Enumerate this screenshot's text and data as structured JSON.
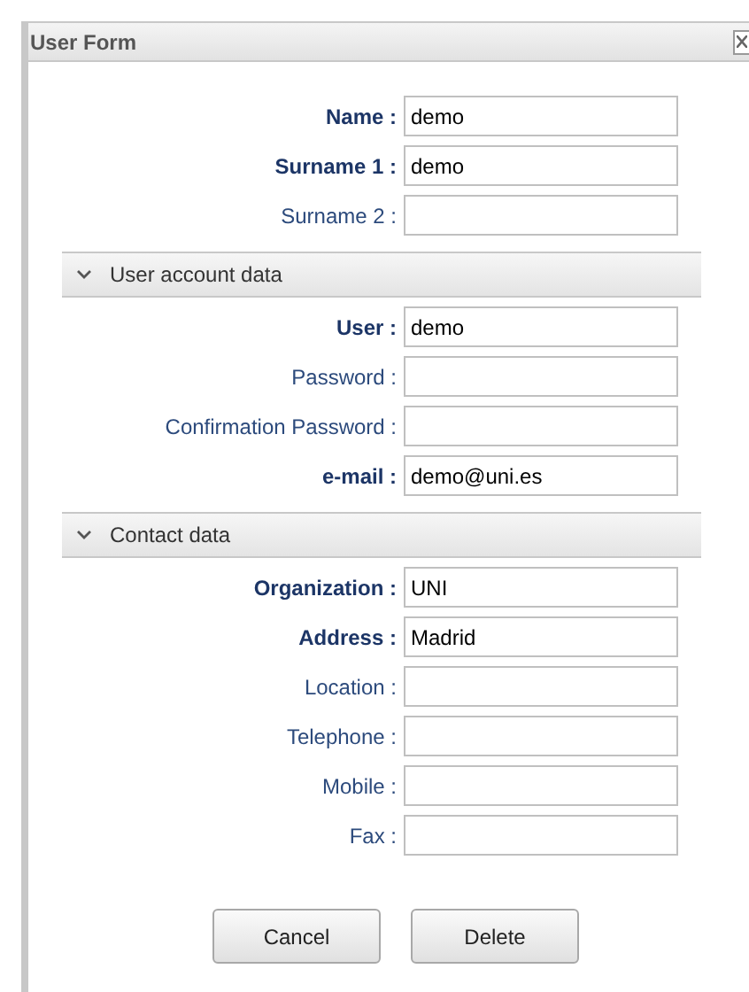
{
  "window": {
    "title": "User Form"
  },
  "sections": [
    {
      "fields": [
        {
          "label": "Name :",
          "value": "demo",
          "required": true
        },
        {
          "label": "Surname 1 :",
          "value": "demo",
          "required": true
        },
        {
          "label": "Surname 2 :",
          "required": false
        }
      ]
    },
    {
      "header": {
        "label": "User account data",
        "expanded": true
      },
      "fields": [
        {
          "label": "User :",
          "value": "demo",
          "required": true
        },
        {
          "label": "Password :",
          "required": false
        },
        {
          "label": "Confirmation Password :",
          "required": false
        },
        {
          "label": "e-mail :",
          "value": "demo@uni.es",
          "required": true
        }
      ]
    },
    {
      "header": {
        "label": "Contact data",
        "expanded": true
      },
      "fields": [
        {
          "label": "Organization :",
          "value": "UNI",
          "required": true
        },
        {
          "label": "Address :",
          "value": "Madrid",
          "required": true
        },
        {
          "label": "Location :",
          "required": false
        },
        {
          "label": "Telephone :",
          "required": false
        },
        {
          "label": "Mobile :",
          "required": false
        },
        {
          "label": "Fax :",
          "required": false
        }
      ]
    }
  ],
  "buttons": [
    "Cancel",
    "Delete"
  ]
}
